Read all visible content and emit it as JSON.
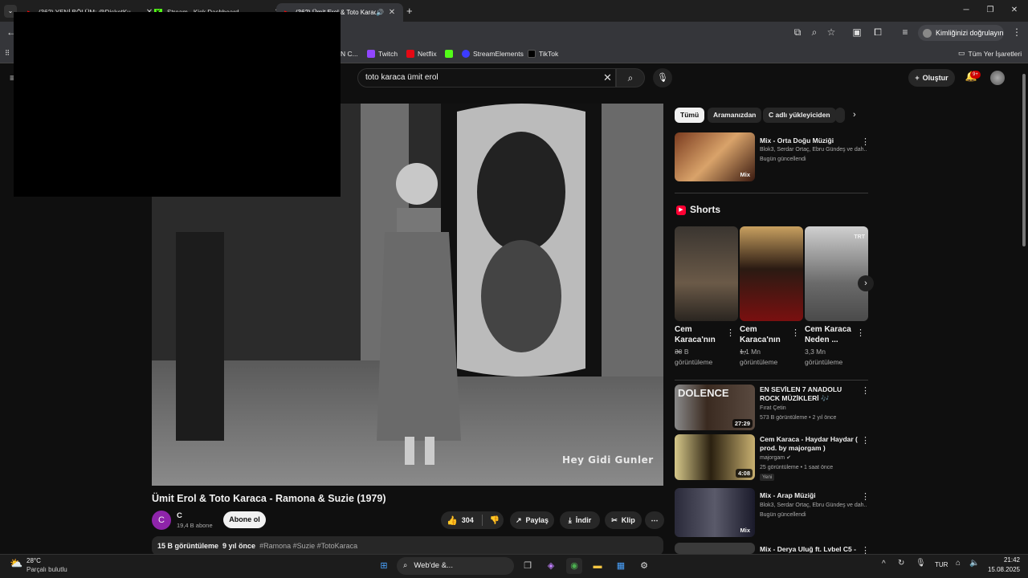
{
  "tabs": [
    {
      "title": "(362) YENİ BÖLÜM: @DisketKu",
      "fav": "▶",
      "favcolor": "#ff0000"
    },
    {
      "title": "Stream - Kick Dashboard",
      "fav": "K",
      "favcolor": "#53fc18"
    },
    {
      "title": "(362) Ümit Erol & Toto Karaca",
      "fav": "▶",
      "favcolor": "#ff0000"
    }
  ],
  "identity_label": "Kimliğinizi doğrulayın",
  "bookmarks": [
    {
      "label": "N C...",
      "color": "#666"
    },
    {
      "label": "Twitch",
      "color": "#9146ff"
    },
    {
      "label": "Netflix",
      "color": "#e50914"
    },
    {
      "label": "",
      "color": "#53fc18"
    },
    {
      "label": "StreamElements",
      "color": "#3c3cff"
    },
    {
      "label": "TikTok",
      "color": "#000"
    }
  ],
  "all_bookmarks": "Tüm Yer İşaretleri",
  "search": {
    "value": "toto karaca ümit erol"
  },
  "create_label": "Oluştur",
  "notif_count": "9+",
  "video": {
    "caption": "Hey Gidi Gunler",
    "title": "Ümit Erol & Toto Karaca - Ramona & Suzie (1979)",
    "channel": "C",
    "channel_initial": "C",
    "subs": "19,4 B abone",
    "subscribe": "Abone ol",
    "likes": "304",
    "share": "Paylaş",
    "download": "İndir",
    "clip": "Klip",
    "views": "15 B görüntüleme",
    "age": "9 yıl önce",
    "tags": "#Ramona #Suzie #TotoKaraca"
  },
  "chips": [
    "Tümü",
    "Aramanızdan",
    "C adlı yükleyiciden"
  ],
  "mix_top": {
    "title": "Mix - Orta Doğu Müziği",
    "meta": "Blok3, Serdar Ortaç, Ebru Gündeş ve dah...",
    "updated": "Bugün güncellendi",
    "badge": "Mix"
  },
  "shorts_heading": "Shorts",
  "shorts": [
    {
      "title": "Cem Karaca'nın ...",
      "views": "30 B",
      "unit": "görüntüleme"
    },
    {
      "title": "Cem Karaca'nın ...",
      "views": "1,1 Mn",
      "unit": "görüntüleme"
    },
    {
      "title": "Cem Karaca Neden ...",
      "views": "3,3 Mn",
      "unit": "görüntüleme"
    }
  ],
  "short_thumb_text": [
    "",
    "",
    "TRT"
  ],
  "rec": [
    {
      "title": "EN SEVİLEN 7 ANADOLU ROCK MÜZİKLERİ 🎶",
      "channel": "Fırat Çetin",
      "meta": "573 B görüntüleme • 2 yıl önce",
      "dur": "27:29",
      "thumbtext": "DOLENCE"
    },
    {
      "title": "Cem Karaca - Haydar Haydar ( prod. by majorgam )",
      "channel": "majorgam ✔",
      "meta": "25 görüntüleme • 1 saat önce",
      "dur": "4:08",
      "badge": "Yeni"
    },
    {
      "title": "Mix - Arap Müziği",
      "channel": "Blok3, Serdar Ortaç, Ebru Gündeş ve dah...",
      "meta": "Bugün güncellendi",
      "dur": "Mix"
    },
    {
      "title": "Mix - Derya Uluğ ft. Lvbel C5 -",
      "channel": "",
      "meta": "",
      "dur": ""
    }
  ],
  "taskbar": {
    "temp": "28°C",
    "weather": "Parçalı bulutlu",
    "search": "Web'de &...",
    "lang": "TUR",
    "time": "21:42",
    "date": "15.08.2025"
  }
}
